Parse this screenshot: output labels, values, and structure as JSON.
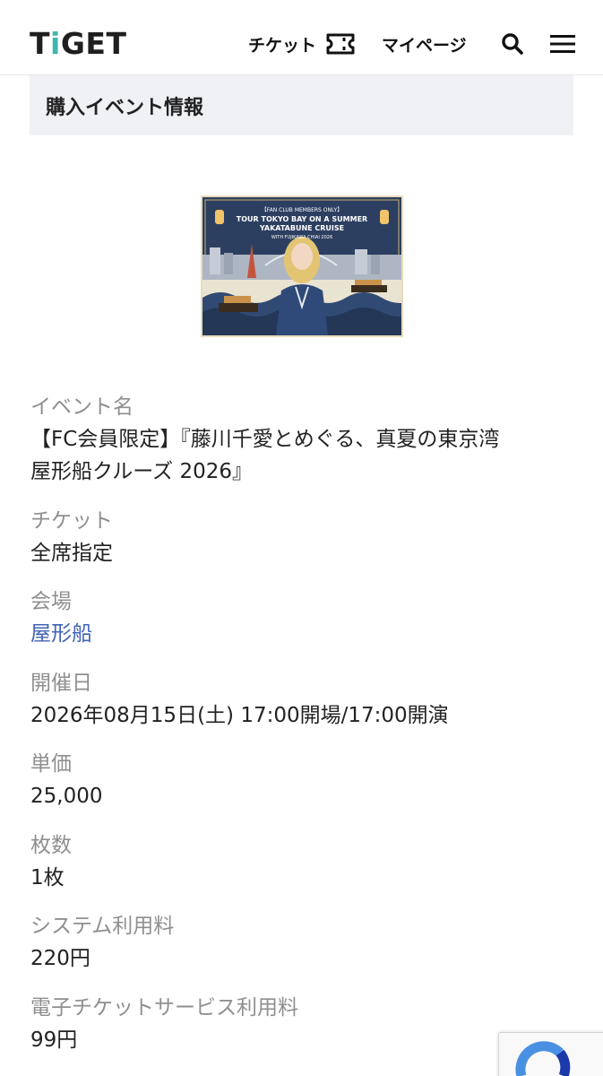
{
  "header": {
    "logo_prefix": "T",
    "logo_accent": "i",
    "logo_suffix": "GET",
    "nav_ticket": "チケット",
    "nav_mypage": "マイページ"
  },
  "section_title": "購入イベント情報",
  "event_image": {
    "line1": "【FAN CLUB MEMBERS ONLY】",
    "line2": "TOUR TOKYO BAY ON A SUMMER",
    "line3": "YAKATABUNE CRUISE",
    "line4": "WITH FUJIKAWA CHIAI 2026"
  },
  "details": {
    "event_name_label": "イベント名",
    "event_name_line1": "【FC会員限定】『藤川千愛とめぐる、真夏の東京湾",
    "event_name_line2": "屋形船クルーズ 2026』",
    "ticket_label": "チケット",
    "ticket_value": "全席指定",
    "venue_label": "会場",
    "venue_value": "屋形船",
    "date_label": "開催日",
    "date_value": "2026年08月15日(土) 17:00開場/17:00開演",
    "price_label": "単価",
    "price_value": "25,000",
    "qty_label": "枚数",
    "qty_value": "1枚",
    "system_fee_label": "システム利用料",
    "system_fee_value": "220円",
    "eticket_fee_label": "電子チケットサービス利用料",
    "eticket_fee_value": "99円"
  },
  "colors": {
    "accent": "#3fb6b0",
    "link": "#4163b5",
    "label_gray": "#8f8f8f",
    "section_bg": "#f0f1f5"
  },
  "icons": [
    "ticket-icon",
    "search-icon",
    "menu-icon",
    "recaptcha-icon"
  ]
}
